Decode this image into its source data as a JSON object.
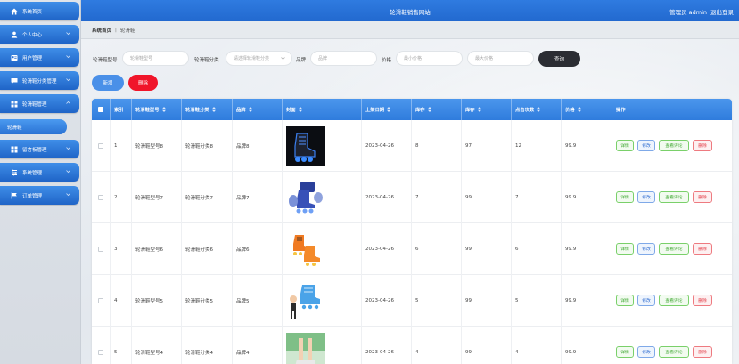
{
  "header": {
    "site_title": "轮滑鞋销售网站",
    "user_label": "管理员 admin",
    "logout": "退出登录"
  },
  "sidebar": {
    "items": [
      {
        "label": "系统首页",
        "icon": "home-icon"
      },
      {
        "label": "个人中心",
        "icon": "user-icon"
      },
      {
        "label": "用户管理",
        "icon": "users-icon"
      },
      {
        "label": "轮滑鞋分类管理",
        "icon": "chat-icon"
      },
      {
        "label": "轮滑鞋管理",
        "icon": "grid-icon"
      },
      {
        "label": "留言板管理",
        "icon": "grid-icon"
      },
      {
        "label": "系统管理",
        "icon": "gear-icon"
      },
      {
        "label": "订单管理",
        "icon": "flag-icon"
      }
    ],
    "active_sub": "轮滑鞋"
  },
  "breadcrumb": {
    "home": "系统首页",
    "current": "轮滑鞋"
  },
  "search": {
    "model_label": "轮滑鞋型号",
    "model_placeholder": "轮滑鞋型号",
    "category_label": "轮滑鞋分类",
    "category_placeholder": "请选择轮滑鞋分类",
    "brand_label": "品牌",
    "brand_placeholder": "品牌",
    "price_label": "价格",
    "min_price_placeholder": "最小价格",
    "max_price_placeholder": "最大价格",
    "search_button": "查询"
  },
  "actions": {
    "add": "新增",
    "delete": "删除"
  },
  "table": {
    "columns": [
      "索引",
      "轮滑鞋型号",
      "轮滑鞋分类",
      "品牌",
      "封面",
      "上架日期",
      "库存",
      "库存",
      "点击次数",
      "价格",
      "操作"
    ],
    "op_labels": {
      "detail": "详情",
      "edit": "修改",
      "review": "查看评论",
      "remove": "删除"
    },
    "rows": [
      {
        "index": "1",
        "model": "轮滑鞋型号8",
        "category": "轮滑鞋分类8",
        "brand": "品牌8",
        "date": "2023-04-26",
        "a": "8",
        "b": "97",
        "clicks": "12",
        "price": "99.9"
      },
      {
        "index": "2",
        "model": "轮滑鞋型号7",
        "category": "轮滑鞋分类7",
        "brand": "品牌7",
        "date": "2023-04-26",
        "a": "7",
        "b": "99",
        "clicks": "7",
        "price": "99.9"
      },
      {
        "index": "3",
        "model": "轮滑鞋型号6",
        "category": "轮滑鞋分类6",
        "brand": "品牌6",
        "date": "2023-04-26",
        "a": "6",
        "b": "99",
        "clicks": "6",
        "price": "99.9"
      },
      {
        "index": "4",
        "model": "轮滑鞋型号5",
        "category": "轮滑鞋分类5",
        "brand": "品牌5",
        "date": "2023-04-26",
        "a": "5",
        "b": "99",
        "clicks": "5",
        "price": "99.9"
      },
      {
        "index": "5",
        "model": "轮滑鞋型号4",
        "category": "轮滑鞋分类4",
        "brand": "品牌4",
        "date": "2023-04-26",
        "a": "4",
        "b": "99",
        "clicks": "4",
        "price": "99.9"
      }
    ]
  },
  "colors": {
    "primary": "#2f7be0",
    "danger": "#f0152a",
    "dark_button": "#2b2d33"
  }
}
